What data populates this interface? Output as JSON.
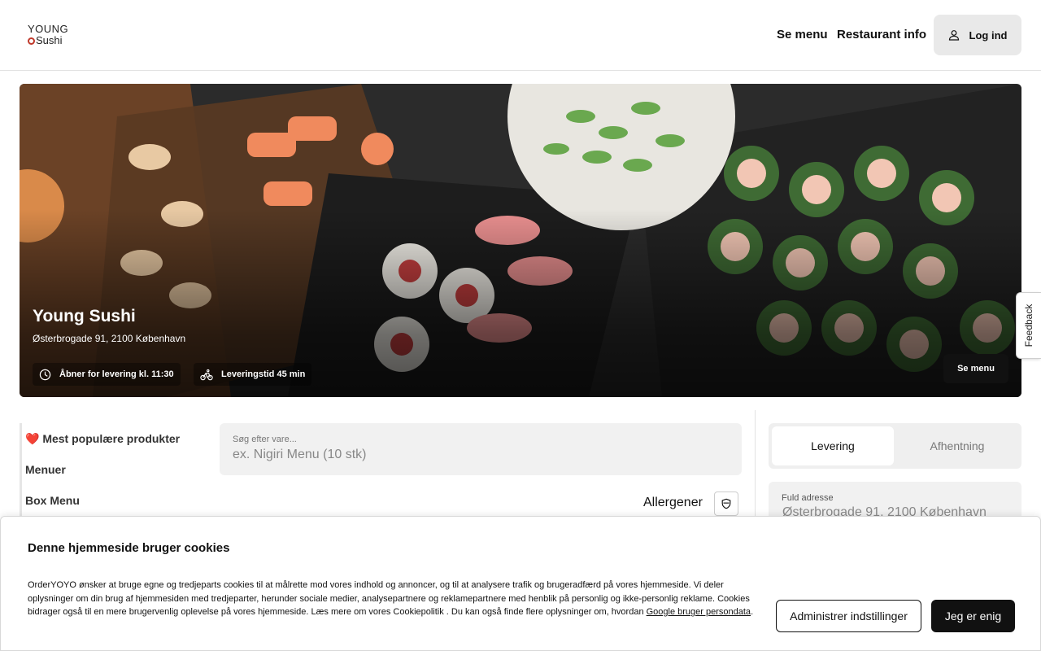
{
  "header": {
    "logo_line1": "YOUNG",
    "logo_line2": "Sushi",
    "nav_menu": "Se menu",
    "nav_info": "Restaurant info",
    "login": "Log ind"
  },
  "hero": {
    "title": "Young Sushi",
    "address": "Østerbrogade 91, 2100 København",
    "opening": "Åbner for levering kl. 11:30",
    "delivery_time": "Leveringstid 45 min",
    "menu_button": "Se menu"
  },
  "feedback": "Feedback",
  "categories": [
    "❤️ Mest populære produkter",
    "Menuer",
    "Box Menu"
  ],
  "search": {
    "label": "Søg efter vare...",
    "placeholder": "ex. Nigiri Menu (10 stk)"
  },
  "allergens": "Allergener",
  "order": {
    "delivery": "Levering",
    "pickup": "Afhentning",
    "address_label": "Fuld adresse",
    "address_value": "Østerbrogade 91, 2100 København"
  },
  "cookie": {
    "title": "Denne hjemmeside bruger cookies",
    "text": "OrderYOYO ønsker at bruge egne og tredjeparts cookies til at målrette mod vores indhold og annoncer, og til at analysere trafik og brugeradfærd på vores hjemmeside. Vi deler oplysninger om din brug af hjemmesiden med tredjeparter, herunder sociale medier, analysepartnere og reklamepartnere med henblik på personlig og ikke-personlig reklame. Cookies bidrager også til en mere brugervenlig oplevelse på vores hjemmeside. Læs mere om vores Cookiepolitik . Du kan også finde flere oplysninger om, hvordan ",
    "link": "Google bruger persondata",
    "text_end": ".",
    "manage": "Administrer indstillinger",
    "agree": "Jeg er enig"
  },
  "colors": {
    "accent": "#111111",
    "logo_red": "#c0392b"
  }
}
